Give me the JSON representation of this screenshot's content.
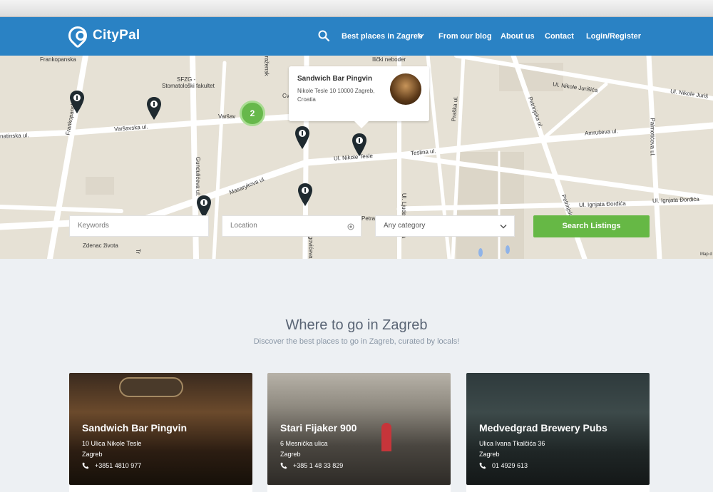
{
  "nav": {
    "brand": "CityPal",
    "links": [
      "Best places in Zagreb",
      "From our blog",
      "About us",
      "Contact",
      "Login/Register"
    ]
  },
  "map": {
    "labels": {
      "frankopanska": "Frankopanska",
      "sfzg": "SFZG -",
      "stomatoloski": "Stomatološki fakultet",
      "varsavska_main": "Varšavska ul.",
      "varsavska_short": "Varšav",
      "atinska": "natinska ul.",
      "frankopanska_v": "Frankopanska",
      "gunduliceva": "Gundulićeva ul.",
      "masarykova": "Masarykova ul.",
      "nikole_tesle": "Ul. Nikole Tesle",
      "teslina": "Teslina ul.",
      "amruseva": "Amruševa ul.",
      "nikole_jurisica": "Ul. Nikole Jurišića",
      "nikole_jurisica2": "Ul. Nikole Juriš",
      "petrinjska": "Petrinjska ul.",
      "petrinjska2": "Petrinjsk",
      "praska": "Praška ul.",
      "palmoticeva": "Palmotićeva ul.",
      "ignjata1": "Ul. Ignjata Đorđića",
      "ignjata2": "Ul. Ignjata Đorđića",
      "ljudevita": "Ul. Ljudevita Gaja",
      "ilicki": "Ilički neboder",
      "zdenac": "Zdenac života",
      "cv": "Cv",
      "petra": "Petra",
      "prazenska": "ražensk",
      "bogoviceva": "ogovićeva",
      "tr": "Tr",
      "mapdata": "Map d"
    },
    "cluster_count": "2",
    "popup": {
      "title": "Sandwich Bar Pingvin",
      "address": "Nikole Tesle 10 10000 Zagreb, Croatia"
    }
  },
  "search": {
    "keywords_placeholder": "Keywords",
    "location_placeholder": "Location",
    "category": "Any category",
    "button": "Search Listings"
  },
  "section": {
    "title": "Where to go in Zagreb",
    "subtitle": "Discover the best places to go in Zagreb, curated by locals!"
  },
  "cards": [
    {
      "title": "Sandwich Bar Pingvin",
      "street": "10 Ulica Nikole Tesle",
      "city": "Zagreb",
      "phone": "+3851 4810 977"
    },
    {
      "title": "Stari Fijaker 900",
      "street": "6 Mesnička ulica",
      "city": "Zagreb",
      "phone": "+385 1 48 33 829"
    },
    {
      "title": "Medvedgrad Brewery Pubs",
      "street": "Ulica Ivana Tkalčića 36",
      "city": "Zagreb",
      "phone": "01 4929 613"
    }
  ],
  "colors": {
    "nav": "#2a82c4",
    "accent_green": "#66b845",
    "cluster_green": "#67b84b"
  },
  "icons": [
    "search-icon",
    "chevron-down-icon",
    "map-pin-icon",
    "location-target-icon",
    "phone-icon"
  ]
}
